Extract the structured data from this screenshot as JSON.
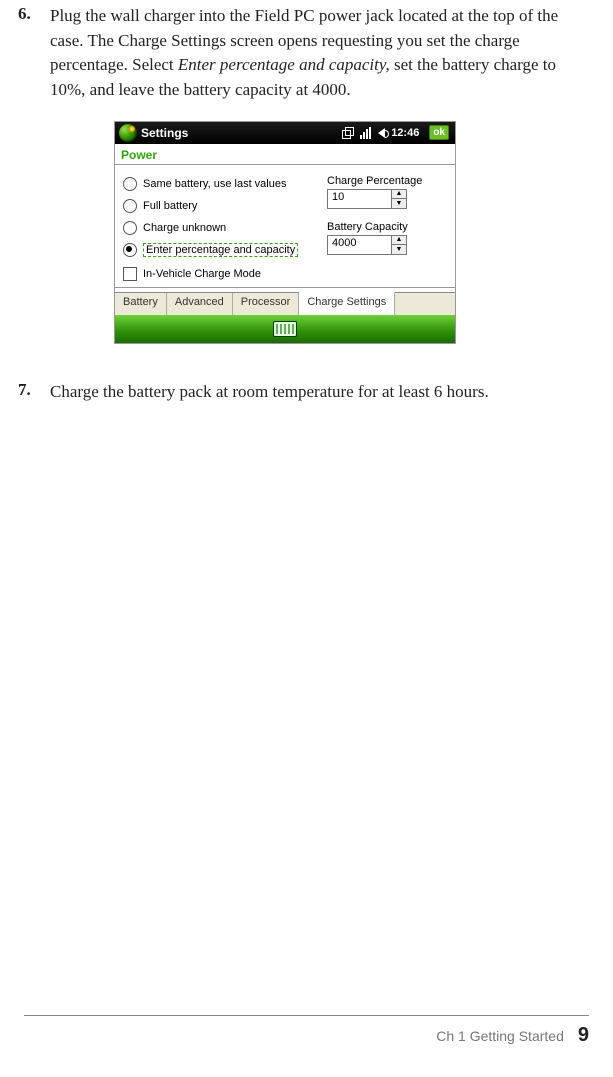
{
  "steps": {
    "s6": {
      "num": "6.",
      "t1": "Plug the wall charger into the Field PC power jack located at the top of the case. The Charge Settings screen opens requesting you set the charge percentage. Select ",
      "it": "Enter percentage and capacity,",
      "t2": " set the battery charge to 10%, and leave the battery capacity at 4000."
    },
    "s7": {
      "num": "7.",
      "text": "Charge the battery pack at room temperature for at least 6 hours."
    }
  },
  "shot": {
    "title": "Settings",
    "clock": "12:46",
    "ok": "ok",
    "section": "Power",
    "radios": {
      "r1": "Same battery, use last values",
      "r2": "Full battery",
      "r3": "Charge unknown",
      "r4": "Enter percentage and capacity"
    },
    "fields": {
      "chargeLabel": "Charge Percentage",
      "chargeVal": "10",
      "capLabel": "Battery Capacity",
      "capVal": "4000"
    },
    "checkbox": "In-Vehicle Charge Mode",
    "tabs": {
      "t1": "Battery",
      "t2": "Advanced",
      "t3": "Processor",
      "t4": "Charge Settings"
    },
    "spin": {
      "up": "▲",
      "down": "▼"
    }
  },
  "footer": {
    "ch": "Ch 1    Getting Started",
    "page": "9"
  }
}
